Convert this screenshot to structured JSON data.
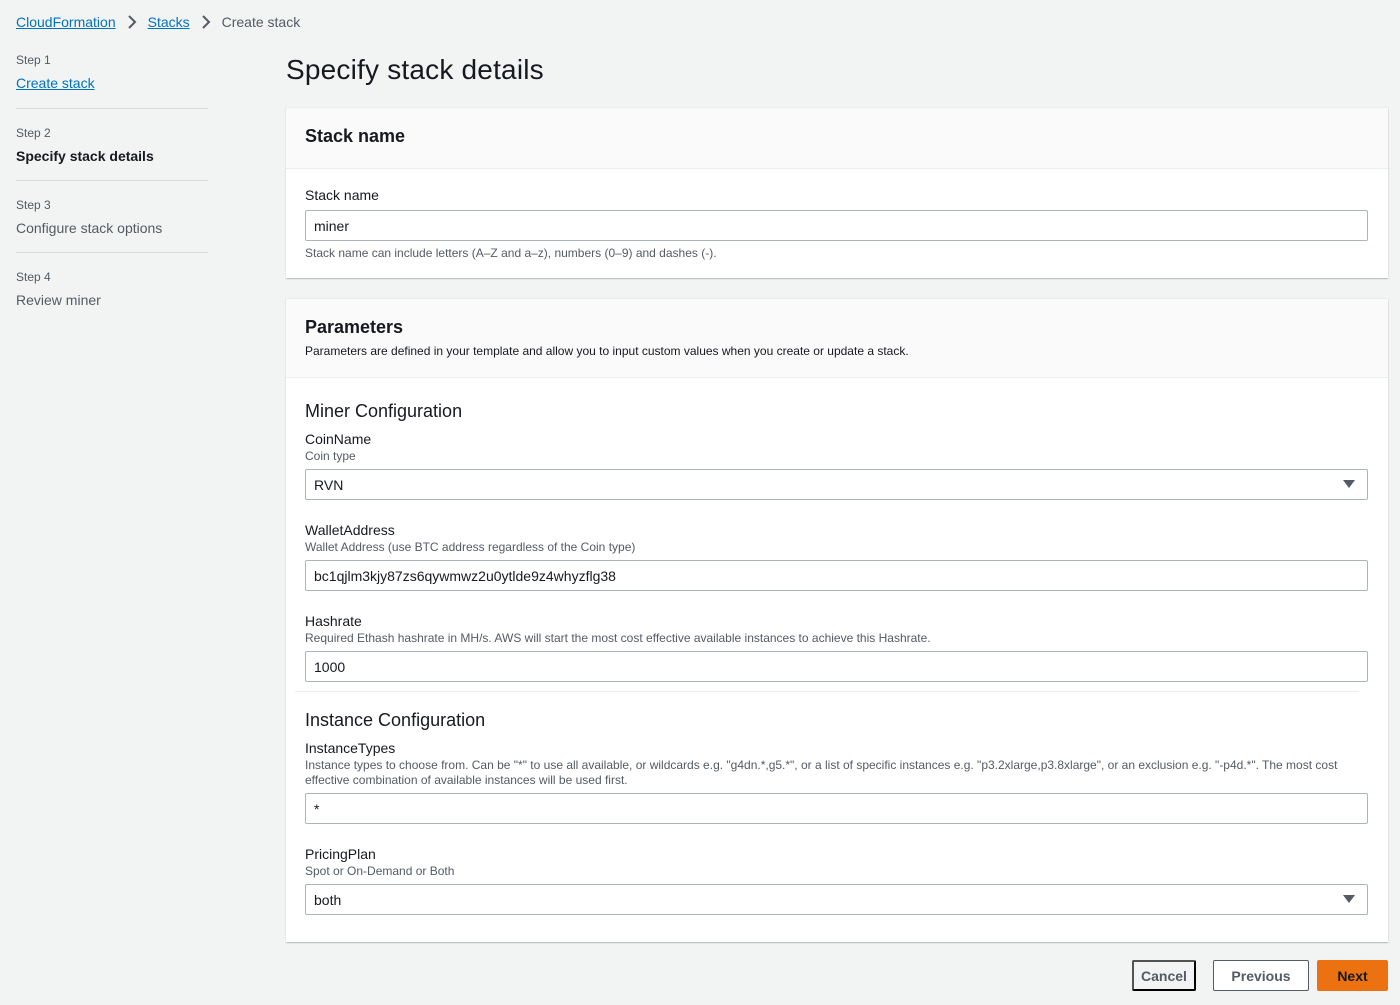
{
  "breadcrumb": {
    "items": [
      "CloudFormation",
      "Stacks"
    ],
    "current": "Create stack"
  },
  "steps": [
    {
      "num": "Step 1",
      "title": "Create stack"
    },
    {
      "num": "Step 2",
      "title": "Specify stack details"
    },
    {
      "num": "Step 3",
      "title": "Configure stack options"
    },
    {
      "num": "Step 4",
      "title": "Review miner"
    }
  ],
  "page_title": "Specify stack details",
  "stack_name_panel": {
    "header": "Stack name",
    "label": "Stack name",
    "value": "miner",
    "hint": "Stack name can include letters (A–Z and a–z), numbers (0–9) and dashes (-)."
  },
  "parameters_panel": {
    "header": "Parameters",
    "description": "Parameters are defined in your template and allow you to input custom values when you create or update a stack.",
    "miner_section": {
      "title": "Miner Configuration",
      "coin_name": {
        "label": "CoinName",
        "desc": "Coin type",
        "value": "RVN"
      },
      "wallet": {
        "label": "WalletAddress",
        "desc": "Wallet Address (use BTC address regardless of the Coin type)",
        "value": "bc1qjlm3kjy87zs6qywmwz2u0ytlde9z4whyzflg38"
      },
      "hashrate": {
        "label": "Hashrate",
        "desc": "Required Ethash hashrate in MH/s. AWS will start the most cost effective available instances to achieve this Hashrate.",
        "value": "1000"
      }
    },
    "instance_section": {
      "title": "Instance Configuration",
      "instance_types": {
        "label": "InstanceTypes",
        "desc": "Instance types to choose from. Can be \"*\" to use all available, or wildcards e.g. \"g4dn.*,g5.*\", or a list of specific instances e.g. \"p3.2xlarge,p3.8xlarge\", or an exclusion e.g. \"-p4d.*\". The most cost effective combination of available instances will be used first.",
        "value": "*"
      },
      "pricing_plan": {
        "label": "PricingPlan",
        "desc": "Spot or On-Demand or Both",
        "value": "both"
      }
    }
  },
  "footer": {
    "cancel": "Cancel",
    "previous": "Previous",
    "next": "Next"
  },
  "colors": {
    "link": "#0073bb",
    "primary_button": "#ec7211",
    "background": "#f2f3f3"
  }
}
